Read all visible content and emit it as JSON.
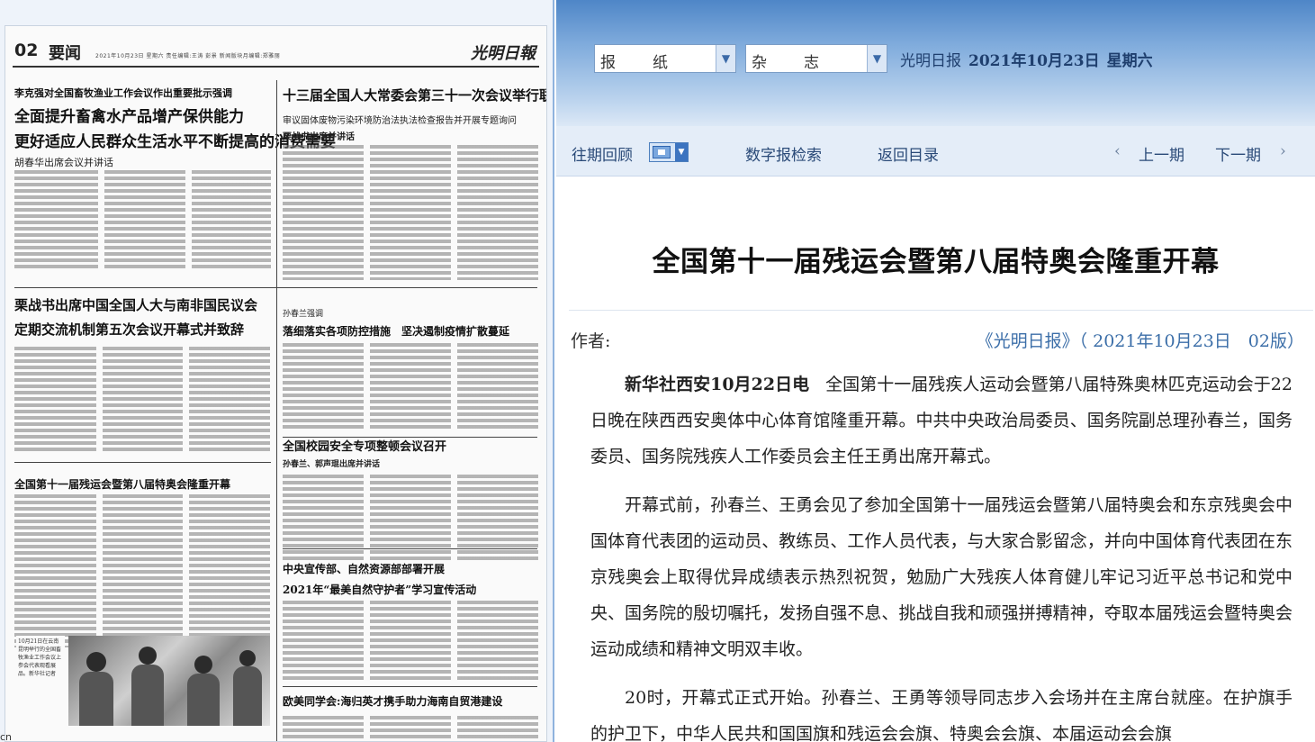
{
  "paper": {
    "page_no": "02",
    "section": "要闻",
    "meta": "2021年10月23日  星期六  责任编辑:王涛  彭景  新闻版块月编辑:郑雅丽",
    "logo": "光明日報",
    "headlines": {
      "a_kicker": "李克强对全国畜牧渔业工作会议作出重要批示强调",
      "a_title1": "全面提升畜禽水产品增产保供能力",
      "a_title2": "更好适应人民群众生活水平不断提高的消费需要",
      "a_sub": "胡春华出席会议并讲话",
      "b_title": "十三届全国人大常委会第三十一次会议举行联组会议",
      "b_sub1": "审议固体废物污染环境防治法执法检查报告并开展专题询问",
      "b_sub2": "栗战书出席并讲话",
      "c_title1": "栗战书出席中国全国人大与南非国民议会",
      "c_title2": "定期交流机制第五次会议开幕式并致辞",
      "d_kicker": "孙春兰强调",
      "d_title": "落细落实各项防控措施　坚决遏制疫情扩散蔓延",
      "e_title": "全国第十一届残运会暨第八届特奥会隆重开幕",
      "f_title": "全国校园安全专项整顿会议召开",
      "f_sub": "孙春兰、郭声琨出席并讲话",
      "g_title1": "中央宣传部、自然资源部部署开展",
      "g_title2": "2021年“最美自然守护者”学习宣传活动",
      "h_title": "欧美同学会:海归英才携手助力海南自贸港建设"
    },
    "photo_caption": "10月21日在云南昆明举行的全国畜牧渔业工作会议上参会代表观看展品。新华社记者"
  },
  "reader": {
    "select_paper": "报　纸",
    "select_magazine": "杂　志",
    "dateline_name": "光明日报",
    "dateline_date": "2021年10月23日",
    "dateline_weekday": "星期六",
    "nav_archive": "往期回顾",
    "nav_search": "数字报检索",
    "nav_toc": "返回目录",
    "nav_prev": "上一期",
    "nav_next": "下一期",
    "article": {
      "title": "全国第十一届残运会暨第八届特奥会隆重开幕",
      "author_label": "作者:",
      "source": "《光明日报》（ 2021年10月23日　02版）",
      "lead": "新华社西安10月22日电",
      "p1": "全国第十一届残疾人运动会暨第八届特殊奥林匹克运动会于22日晚在陕西西安奥体中心体育馆隆重开幕。中共中央政治局委员、国务院副总理孙春兰，国务委员、国务院残疾人工作委员会主任王勇出席开幕式。",
      "p2": "开幕式前，孙春兰、王勇会见了参加全国第十一届残运会暨第八届特奥会和东京残奥会中国体育代表团的运动员、教练员、工作人员代表，与大家合影留念，并向中国体育代表团在东京残奥会上取得优异成绩表示热烈祝贺，勉励广大残疾人体育健儿牢记习近平总书记和党中央、国务院的殷切嘱托，发扬自强不息、挑战自我和顽强拼搏精神，夺取本届残运会暨特奥会运动成绩和精神文明双丰收。",
      "p3": "20时，开幕式正式开始。孙春兰、王勇等领导同志步入会场并在主席台就座。在护旗手的护卫下，中华人民共和国国旗和残运会会旗、特奥会会旗、本届运动会会旗"
    },
    "status_text": "cn"
  }
}
